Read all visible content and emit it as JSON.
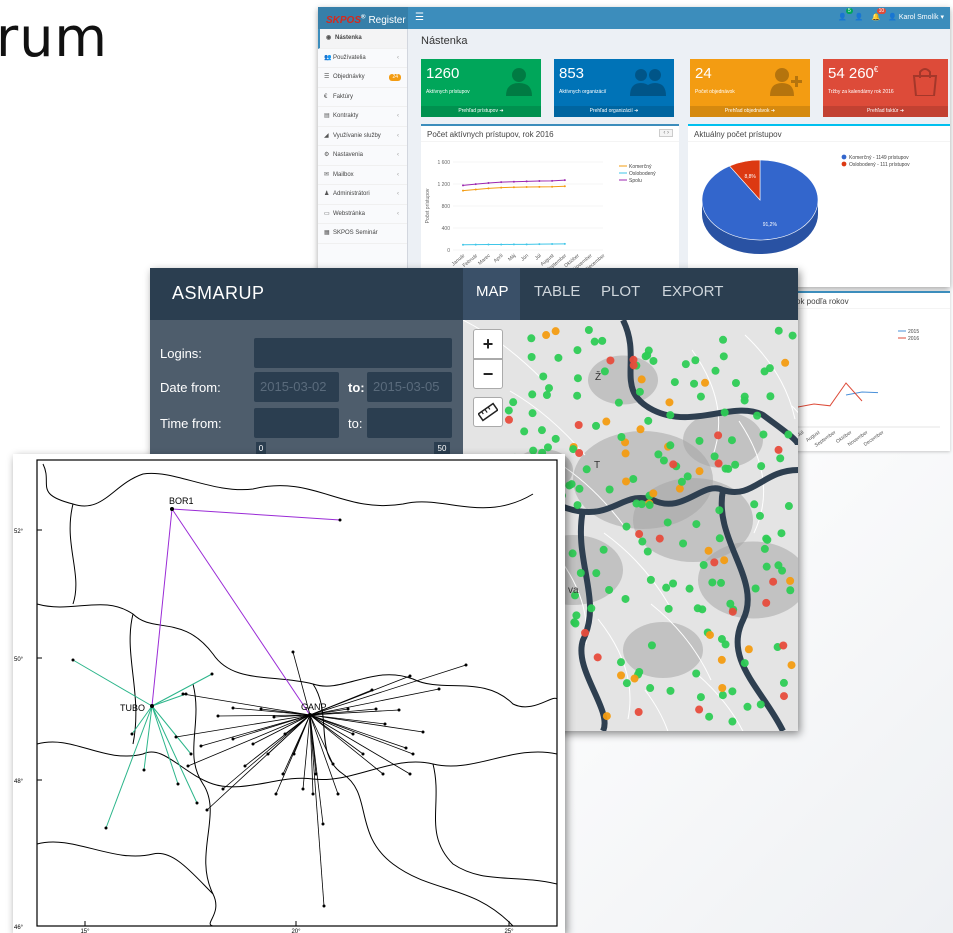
{
  "slide": {
    "title_fragment": "rum"
  },
  "skpos": {
    "brand": "SKPOS",
    "brand_reg": "®",
    "brand_suffix": "Register",
    "page_heading": "Nástenka",
    "user_name": "Karol Smolík",
    "topbar_badges": [
      "5",
      "",
      "10"
    ],
    "sidebar": [
      {
        "label": "Nástenka",
        "icon": "dashboard-icon",
        "active": true,
        "has_arrow": false
      },
      {
        "label": "Používatelia",
        "icon": "users-icon",
        "has_arrow": true
      },
      {
        "label": "Objednávky",
        "icon": "orders-icon",
        "badge": "24"
      },
      {
        "label": "Faktúry",
        "icon": "euro-icon"
      },
      {
        "label": "Kontrakty",
        "icon": "contract-icon",
        "has_arrow": true
      },
      {
        "label": "Využívanie služby",
        "icon": "chart-icon",
        "has_arrow": true
      },
      {
        "label": "Nastavenia",
        "icon": "settings-icon",
        "has_arrow": true
      },
      {
        "label": "Mailbox",
        "icon": "mail-icon",
        "has_arrow": true
      },
      {
        "label": "Administrátori",
        "icon": "admin-icon",
        "has_arrow": true
      },
      {
        "label": "Webstránka",
        "icon": "web-icon",
        "has_arrow": true
      },
      {
        "label": "SKPOS Seminár",
        "icon": "calendar-icon"
      }
    ],
    "stats": [
      {
        "value": "1260",
        "label": "Aktívnych prístupov",
        "link": "Prehľad prístupov",
        "color": "#00a65a"
      },
      {
        "value": "853",
        "label": "Aktívnych organizácií",
        "link": "Prehľad organizácií",
        "color": "#0073b7"
      },
      {
        "value": "24",
        "label": "Počet objednávok",
        "link": "Prehľad objednávok",
        "color": "#f39c12"
      },
      {
        "value": "54 260",
        "value_unit": "€",
        "label": "Tržby za kalendárny rok 2016",
        "link": "Prehľad faktúr",
        "color": "#dd4b39"
      }
    ],
    "line_box_title": "Počet aktívnych prístupov, rok 2016",
    "pie_box_title": "Aktuálny počet prístupov",
    "bottom_box_title_fragment": "ok podľa rokov"
  },
  "asmarup": {
    "title": "ASMARUP",
    "tabs": [
      "MAP",
      "TABLE",
      "PLOT",
      "EXPORT"
    ],
    "active_tab": "MAP",
    "logins_label": "Logins:",
    "date_from_label": "Date from:",
    "date_from_value": "2015-03-02",
    "date_to_label": "to:",
    "date_to_value": "2015-03-05",
    "time_from_label": "Time from:",
    "time_to_label": "to:",
    "slider_min": "0",
    "slider_max": "50",
    "zoom_in": "+",
    "zoom_out": "−",
    "map_labels": [
      "Ž",
      "T",
      "Tr",
      "va"
    ]
  },
  "gnss": {
    "station_labels": [
      "BOR1",
      "TUBO",
      "GANP"
    ],
    "lat_ticks": [
      "52°",
      "50°",
      "48°",
      "46°"
    ],
    "lon_ticks": [
      "15°",
      "20°",
      "25°"
    ]
  },
  "chart_data": [
    {
      "type": "line",
      "title": "Počet aktívnych prístupov, rok 2016",
      "ylabel": "Počet prístupov",
      "categories": [
        "Január",
        "Február",
        "Marec",
        "Apríl",
        "Máj",
        "Jún",
        "Júl",
        "August",
        "September",
        "Október",
        "November",
        "December"
      ],
      "ylim": [
        0,
        1600
      ],
      "yticks": [
        "0",
        "400",
        "800",
        "1 200",
        "1 600"
      ],
      "series": [
        {
          "name": "Komerčný",
          "color": "#f39c12",
          "values": [
            1080,
            1100,
            1120,
            1135,
            1140,
            1145,
            1148,
            1149,
            1160,
            null,
            null,
            null
          ]
        },
        {
          "name": "Oslobodený",
          "color": "#3fc6e8",
          "values": [
            95,
            97,
            99,
            100,
            102,
            103,
            106,
            108,
            111,
            null,
            null,
            null
          ]
        },
        {
          "name": "Spolu",
          "color": "#9c27b0",
          "values": [
            1175,
            1197,
            1219,
            1235,
            1242,
            1248,
            1254,
            1257,
            1271,
            null,
            null,
            null
          ]
        }
      ],
      "legend": "top-right"
    },
    {
      "type": "pie",
      "title": "Aktuálny počet prístupov",
      "labels": [
        "Komerčný - 1149 prístupov",
        "Oslobodený - 111 prístupov"
      ],
      "values": [
        91.2,
        8.8
      ],
      "slice_labels": [
        "91,2%",
        "8,8%"
      ],
      "colors": [
        "#3366cc",
        "#dc3912"
      ],
      "legend": "top-right"
    },
    {
      "type": "line",
      "title": "ok podľa rokov",
      "categories": [
        "Júl",
        "August",
        "September",
        "Október",
        "November",
        "December"
      ],
      "series": [
        {
          "name": "2015",
          "color": "#4a90d9",
          "values": [
            null,
            null,
            null,
            40,
            45,
            44
          ]
        },
        {
          "name": "2016",
          "color": "#dd4b39",
          "values": [
            20,
            25,
            22,
            60,
            30,
            null
          ]
        }
      ],
      "legend": "top-right"
    }
  ]
}
